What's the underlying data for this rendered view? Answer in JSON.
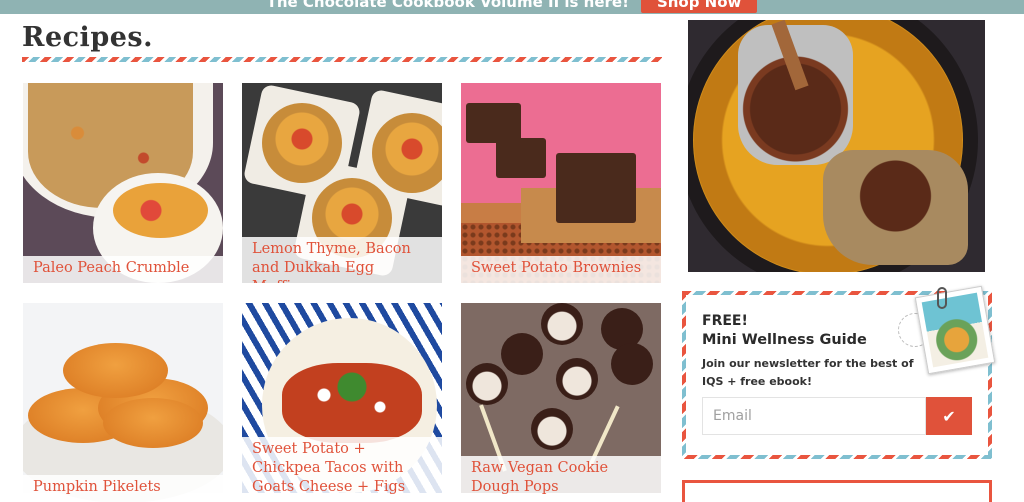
{
  "promo": {
    "text": "The Chocolate Cookbook Volume II is here!",
    "button": "Shop Now"
  },
  "section": {
    "title": "Recipes."
  },
  "recipes": [
    {
      "title": "Paleo Peach Crumble"
    },
    {
      "title": "Lemon Thyme, Bacon and Dukkah Egg Muffins"
    },
    {
      "title": "Sweet Potato Brownies"
    },
    {
      "title": "Pumpkin Pikelets"
    },
    {
      "title": "Sweet Potato + Chickpea Tacos with Goats Cheese + Figs"
    },
    {
      "title": "Raw Vegan Cookie Dough Pops"
    }
  ],
  "newsletter": {
    "free": "FREE!",
    "title": "Mini Wellness Guide",
    "description": "Join our newsletter for the best of IQS + free ebook!",
    "email_placeholder": "Email",
    "submit_icon": "✔"
  },
  "colors": {
    "accent": "#e0523a",
    "banner": "#8fb3b3",
    "stripe_blue": "#7fbfd0"
  },
  "icons": {
    "submit": "checkmark-icon"
  }
}
